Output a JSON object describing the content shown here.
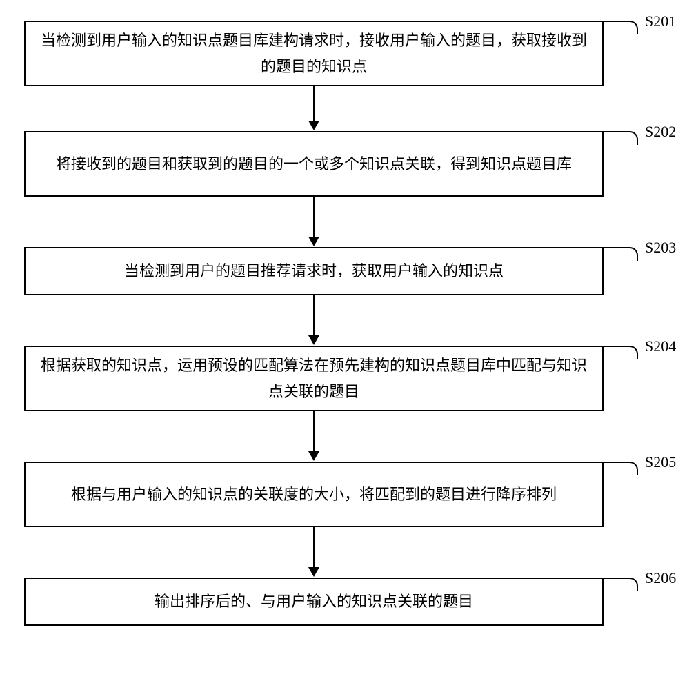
{
  "chart_data": {
    "type": "flowchart",
    "direction": "top-to-bottom",
    "title": "",
    "steps": [
      {
        "id": "S201",
        "text": "当检测到用户输入的知识点题目库建构请求时，接收用户输入的题目，获取接收到的题目的知识点"
      },
      {
        "id": "S202",
        "text": "将接收到的题目和获取到的题目的一个或多个知识点关联，得到知识点题目库"
      },
      {
        "id": "S203",
        "text": "当检测到用户的题目推荐请求时，获取用户输入的知识点"
      },
      {
        "id": "S204",
        "text": "根据获取的知识点，运用预设的匹配算法在预先建构的知识点题目库中匹配与知识点关联的题目"
      },
      {
        "id": "S205",
        "text": "根据与用户输入的知识点的关联度的大小，将匹配到的题目进行降序排列"
      },
      {
        "id": "S206",
        "text": "输出排序后的、与用户输入的知识点关联的题目"
      }
    ],
    "edges": [
      {
        "from": "S201",
        "to": "S202"
      },
      {
        "from": "S202",
        "to": "S203"
      },
      {
        "from": "S203",
        "to": "S204"
      },
      {
        "from": "S204",
        "to": "S205"
      },
      {
        "from": "S205",
        "to": "S206"
      }
    ]
  }
}
